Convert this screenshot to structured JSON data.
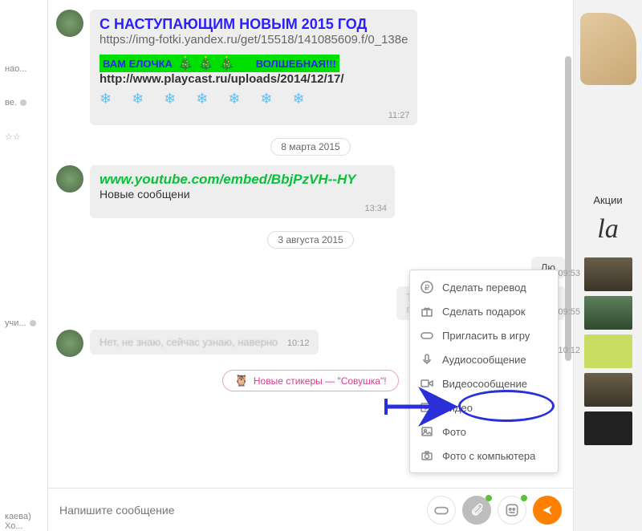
{
  "left": {
    "items": [
      "нао...",
      "ве.",
      "учи...",
      "каева)\n Хо..."
    ],
    "stars": "☆☆"
  },
  "messages": {
    "greet": {
      "title": "С НАСТУПАЮЩИМ НОВЫМ 2015 ГОД",
      "url1": "https://img-fotki.yandex.ru/get/15518/141085609.f/0_138e",
      "tree_left": "ВАМ ЕЛОЧКА",
      "tree_right": "ВОЛШЕБНАЯ!!!",
      "url2": "http://www.playcast.ru/uploads/2014/12/17/",
      "snow": "❄ ❄ ❄ ❄ ❄ ❄ ❄",
      "time": "11:27"
    },
    "date1": "8 марта 2015",
    "yt": {
      "link": "www.youtube.com/embed/BbjPzVH--HY",
      "note": "Новые сообщени",
      "time": "13:34"
    },
    "date2": "3 августа 2015",
    "m1": {
      "text": "Лю",
      "time": "09:53"
    },
    "m2": {
      "line1": "Ты знаешь, что сегодня при...",
      "line2": "прическу: Красиво, скажи, во с",
      "time": "09:55"
    },
    "m3": {
      "text": "Нет, не знаю, сейчас узнаю, наверно",
      "time": "10:12",
      "time2": "10:12"
    },
    "stickers": "Новые стикеры — \"Совушка\"!"
  },
  "attach_menu": {
    "items": [
      {
        "label": "Сделать перевод"
      },
      {
        "label": "Сделать подарок"
      },
      {
        "label": "Пригласить в игру"
      },
      {
        "label": "Аудиосообщение"
      },
      {
        "label": "Видеосообщение"
      },
      {
        "label": "Видео"
      },
      {
        "label": "Фото"
      },
      {
        "label": "Фото с компьютера"
      }
    ]
  },
  "composer": {
    "placeholder": "Напишите сообщение"
  },
  "right": {
    "promo": "Акции",
    "logo": "la"
  },
  "thumbs": {
    "t1": "09:53",
    "t2": "09:55",
    "t3": "10:12"
  }
}
